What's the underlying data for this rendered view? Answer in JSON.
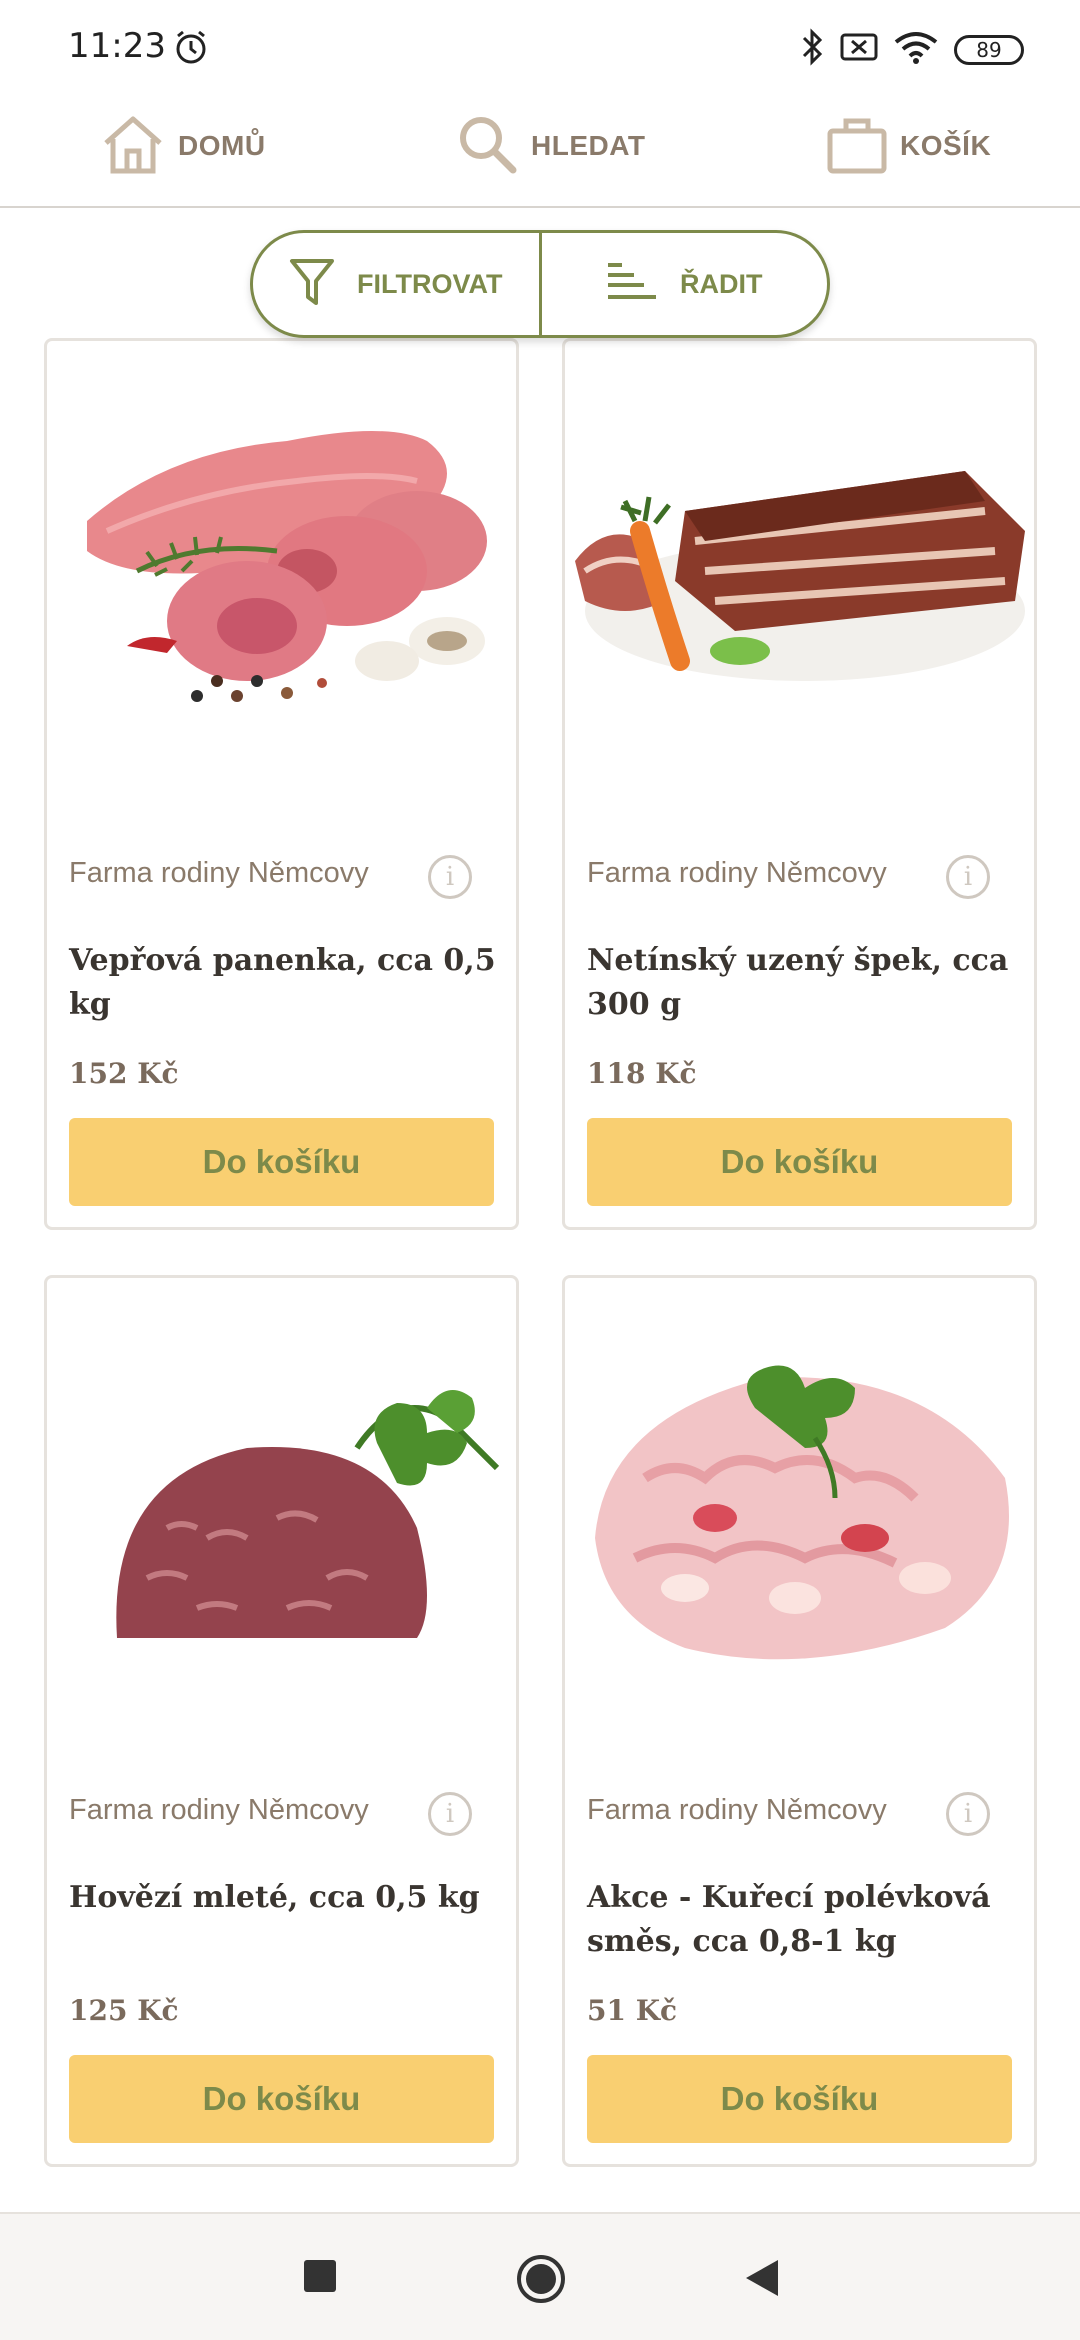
{
  "status_bar": {
    "time": "11:23",
    "battery": "89",
    "icons": [
      "alarm-icon",
      "bluetooth-icon",
      "sim-off-icon",
      "wifi-icon",
      "battery-icon"
    ]
  },
  "top_nav": {
    "home_label": "DOMŮ",
    "search_label": "HLEDAT",
    "cart_label": "KOŠÍK"
  },
  "filter_bar": {
    "filter_label": "FILTROVAT",
    "sort_label": "ŘADIT"
  },
  "products": [
    {
      "farm": "Farma rodiny Němcovy",
      "name": "Vepřová panenka, cca 0,5 kg",
      "price": "152 Kč",
      "button": "Do košíku",
      "image": "pork-tenderloin"
    },
    {
      "farm": "Farma rodiny Němcovy",
      "name": "Netínský uzený špek, cca 300 g",
      "price": "118 Kč",
      "button": "Do košíku",
      "image": "smoked-bacon"
    },
    {
      "farm": "Farma rodiny Němcovy",
      "name": "Hovězí mleté, cca 0,5 kg",
      "price": "125 Kč",
      "button": "Do košíku",
      "image": "ground-beef"
    },
    {
      "farm": "Farma rodiny Němcovy",
      "name": "Akce - Kuřecí polévková směs, cca 0,8-1 kg",
      "price": "51 Kč",
      "button": "Do košíku",
      "image": "chicken-soup-mix"
    }
  ],
  "colors": {
    "accent_green": "#7d8a4a",
    "button_yellow": "#f9cf71",
    "muted_brown": "#8a7a6a"
  }
}
